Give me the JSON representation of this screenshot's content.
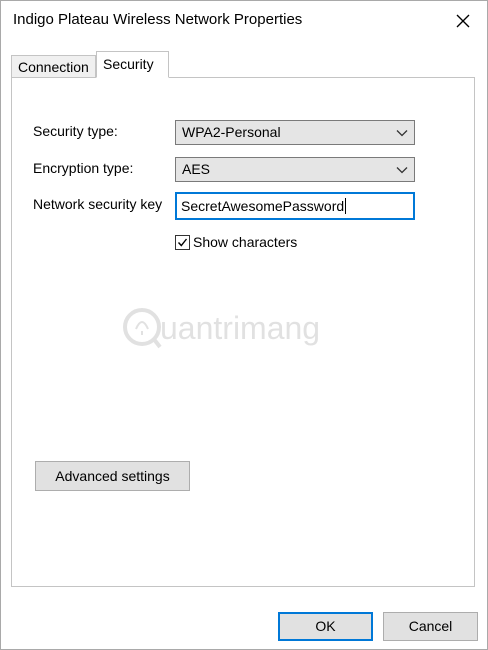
{
  "window": {
    "title": "Indigo Plateau Wireless Network Properties"
  },
  "tabs": [
    {
      "label": "Connection",
      "selected": false
    },
    {
      "label": "Security",
      "selected": true
    }
  ],
  "security": {
    "security_type_label": "Security type:",
    "security_type_value": "WPA2-Personal",
    "encryption_type_label": "Encryption type:",
    "encryption_type_value": "AES",
    "network_key_label": "Network security key",
    "network_key_value": "SecretAwesomePassword",
    "show_characters_label": "Show characters",
    "show_characters_checked": true,
    "advanced_settings_label": "Advanced settings"
  },
  "watermark": {
    "text": "uantrimang"
  },
  "footer": {
    "ok_label": "OK",
    "cancel_label": "Cancel"
  },
  "colors": {
    "accent": "#0078d7",
    "button_bg": "#e1e1e1",
    "select_bg": "#e5e5e5"
  },
  "icons": {
    "close": "close-icon",
    "dropdown": "chevron-down-icon",
    "checkmark": "checkmark-icon",
    "watermark_logo": "quantrimang-logo"
  }
}
